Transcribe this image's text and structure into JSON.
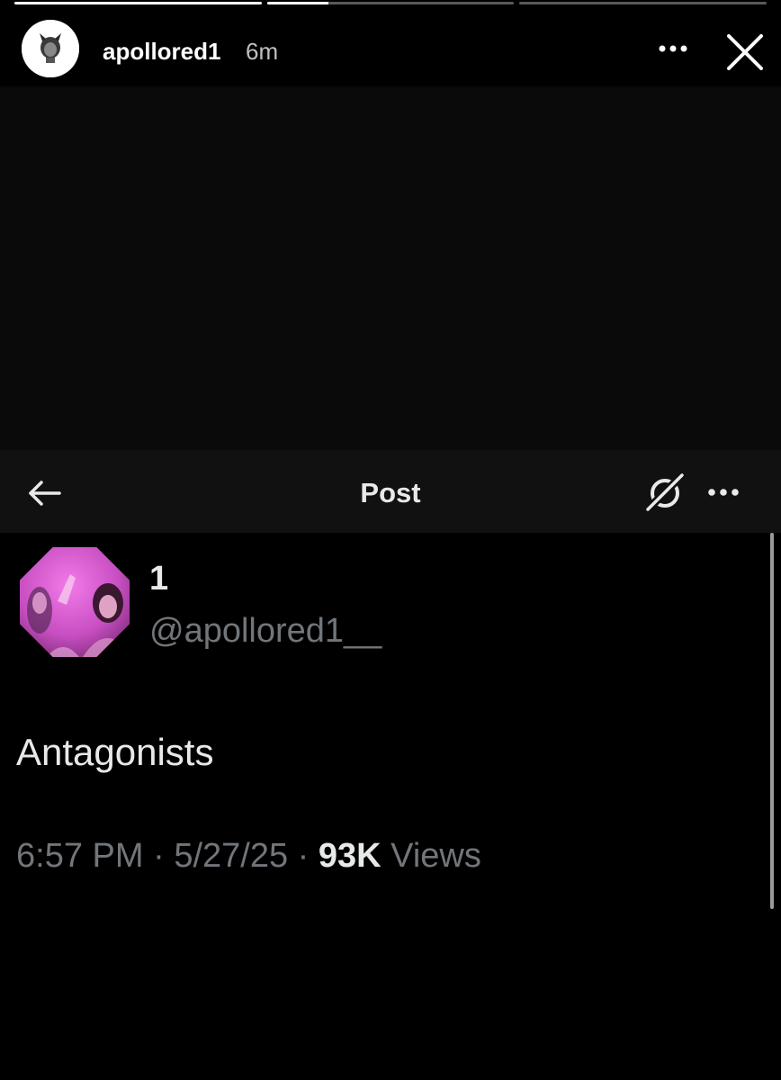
{
  "story": {
    "progress": [
      1,
      0.25,
      0
    ],
    "username": "apollored1",
    "time_ago": "6m",
    "more_icon": "more-horizontal-icon",
    "close_icon": "close-icon"
  },
  "post_header": {
    "title": "Post",
    "back_icon": "arrow-left-icon",
    "grok_icon": "grok-icon",
    "more_icon": "more-horizontal-icon"
  },
  "post": {
    "author_name": "1",
    "author_handle": "@apollored1__",
    "text": "Antagonists",
    "time": "6:57 PM",
    "date": "5/27/25",
    "views_count": "93K",
    "views_label": "Views",
    "separator": "·"
  },
  "colors": {
    "background": "#000000",
    "header_bar": "#111112",
    "muted_text": "#71767b",
    "primary_text": "#e7e9ea",
    "avatar_pink": "#d14fc8"
  }
}
